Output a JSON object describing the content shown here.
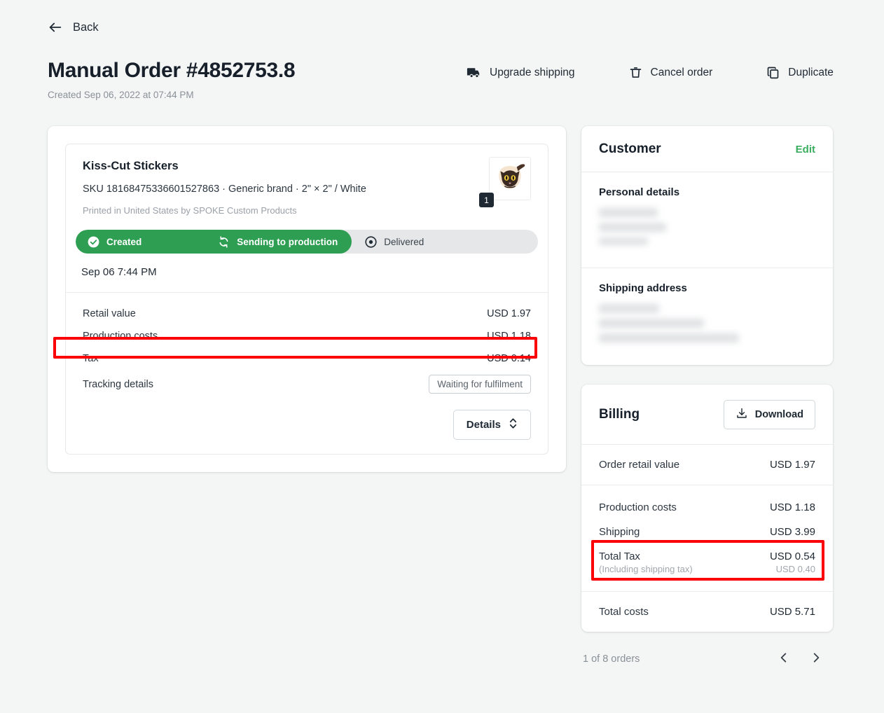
{
  "header": {
    "back_label": "Back",
    "title": "Manual Order #4852753.8",
    "subtitle": "Created Sep 06, 2022 at 07:44 PM",
    "actions": [
      {
        "label": "Upgrade shipping",
        "icon": "truck-icon"
      },
      {
        "label": "Cancel order",
        "icon": "trash-icon"
      },
      {
        "label": "Duplicate",
        "icon": "copy-icon"
      }
    ]
  },
  "order_item": {
    "name": "Kiss-Cut Stickers",
    "sku_line": "SKU 18168475336601527863  · Generic brand · 2\" × 2\" / White",
    "printed_by": "Printed in United States by SPOKE Custom Products",
    "quantity": "1",
    "status_steps": [
      {
        "label": "Created",
        "state": "done",
        "icon": "check-circle-icon"
      },
      {
        "label": "Sending to production",
        "state": "done",
        "icon": "sync-icon"
      },
      {
        "label": "Delivered",
        "state": "pending",
        "icon": "dot-circle-icon"
      }
    ],
    "status_date": "Sep 06 7:44 PM",
    "costs": [
      {
        "label": "Retail value",
        "value": "USD 1.97"
      },
      {
        "label": "Production costs",
        "value": "USD 1.18"
      },
      {
        "label": "Tax",
        "value": "USD 0.14",
        "highlighted": true
      }
    ],
    "tracking_label": "Tracking details",
    "tracking_status": "Waiting for fulfilment",
    "details_button": "Details"
  },
  "customer": {
    "title": "Customer",
    "edit_label": "Edit",
    "personal_details_label": "Personal details",
    "shipping_address_label": "Shipping address"
  },
  "billing": {
    "title": "Billing",
    "download_label": "Download",
    "order_retail": {
      "label": "Order retail value",
      "value": "USD 1.97"
    },
    "rows": [
      {
        "label": "Production costs",
        "value": "USD 1.18"
      },
      {
        "label": "Shipping",
        "value": "USD 3.99"
      }
    ],
    "total_tax": {
      "label": "Total Tax",
      "value": "USD 0.54",
      "sub_label": "(Including shipping tax)",
      "sub_value": "USD 0.40"
    },
    "total_costs": {
      "label": "Total costs",
      "value": "USD 5.71"
    }
  },
  "pagination": {
    "text": "1 of 8 orders",
    "prev_icon": "chevron-left-icon",
    "next_icon": "chevron-right-icon"
  },
  "colors": {
    "accent_green": "#2e9e52",
    "link_green": "#3aad5f",
    "highlight_red": "#fb0007",
    "page_bg": "#f4f5f5"
  }
}
